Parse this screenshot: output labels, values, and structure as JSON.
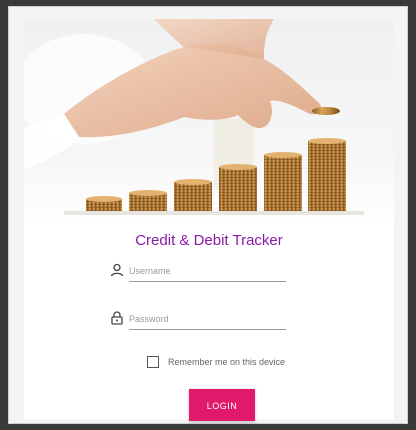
{
  "app": {
    "title": "Credit & Debit Tracker"
  },
  "hero": {
    "icon": "coins-stacks-hand-image"
  },
  "form": {
    "username": {
      "placeholder": "Username",
      "value": "",
      "icon": "user-icon"
    },
    "password": {
      "placeholder": "Password",
      "value": "",
      "icon": "lock-icon"
    },
    "remember": {
      "label": "Remember me on this device",
      "checked": false
    },
    "login_label": "LOGIN"
  },
  "colors": {
    "title": "#8a1aa8",
    "login_button": "#e0196b",
    "background": "#3a3a3a"
  }
}
